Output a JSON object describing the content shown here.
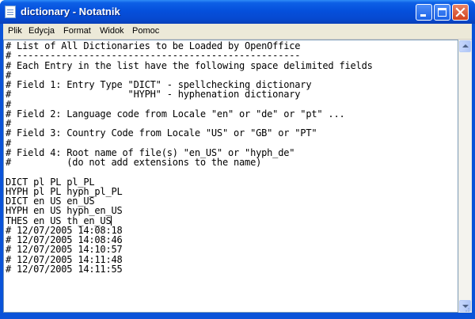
{
  "window": {
    "title": "dictionary - Notatnik",
    "colors": {
      "titlebar": "#0550dc",
      "close_button": "#d2411c",
      "menubar": "#ece9d8"
    }
  },
  "menu": {
    "items": [
      "Plik",
      "Edycja",
      "Format",
      "Widok",
      "Pomoc"
    ]
  },
  "editor": {
    "lines": [
      "# List of All Dictionaries to be Loaded by OpenOffice",
      "# ---------------------------------------------------",
      "# Each Entry in the list have the following space delimited fields",
      "#",
      "# Field 1: Entry Type \"DICT\" - spellchecking dictionary",
      "#                     \"HYPH\" - hyphenation dictionary",
      "#",
      "# Field 2: Language code from Locale \"en\" or \"de\" or \"pt\" ...",
      "#",
      "# Field 3: Country Code from Locale \"US\" or \"GB\" or \"PT\"",
      "#",
      "# Field 4: Root name of file(s) \"en_US\" or \"hyph_de\"",
      "#          (do not add extensions to the name)",
      "",
      "DICT pl PL pl_PL",
      "HYPH pl PL hyph_pl_PL",
      "DICT en US en_US",
      "HYPH en US hyph_en_US",
      "THES en US th_en_US",
      "# 12/07/2005 14:08:18",
      "# 12/07/2005 14:08:46",
      "# 12/07/2005 14:10:57",
      "# 12/07/2005 14:11:48",
      "# 12/07/2005 14:11:55"
    ],
    "caret_line": 18
  }
}
